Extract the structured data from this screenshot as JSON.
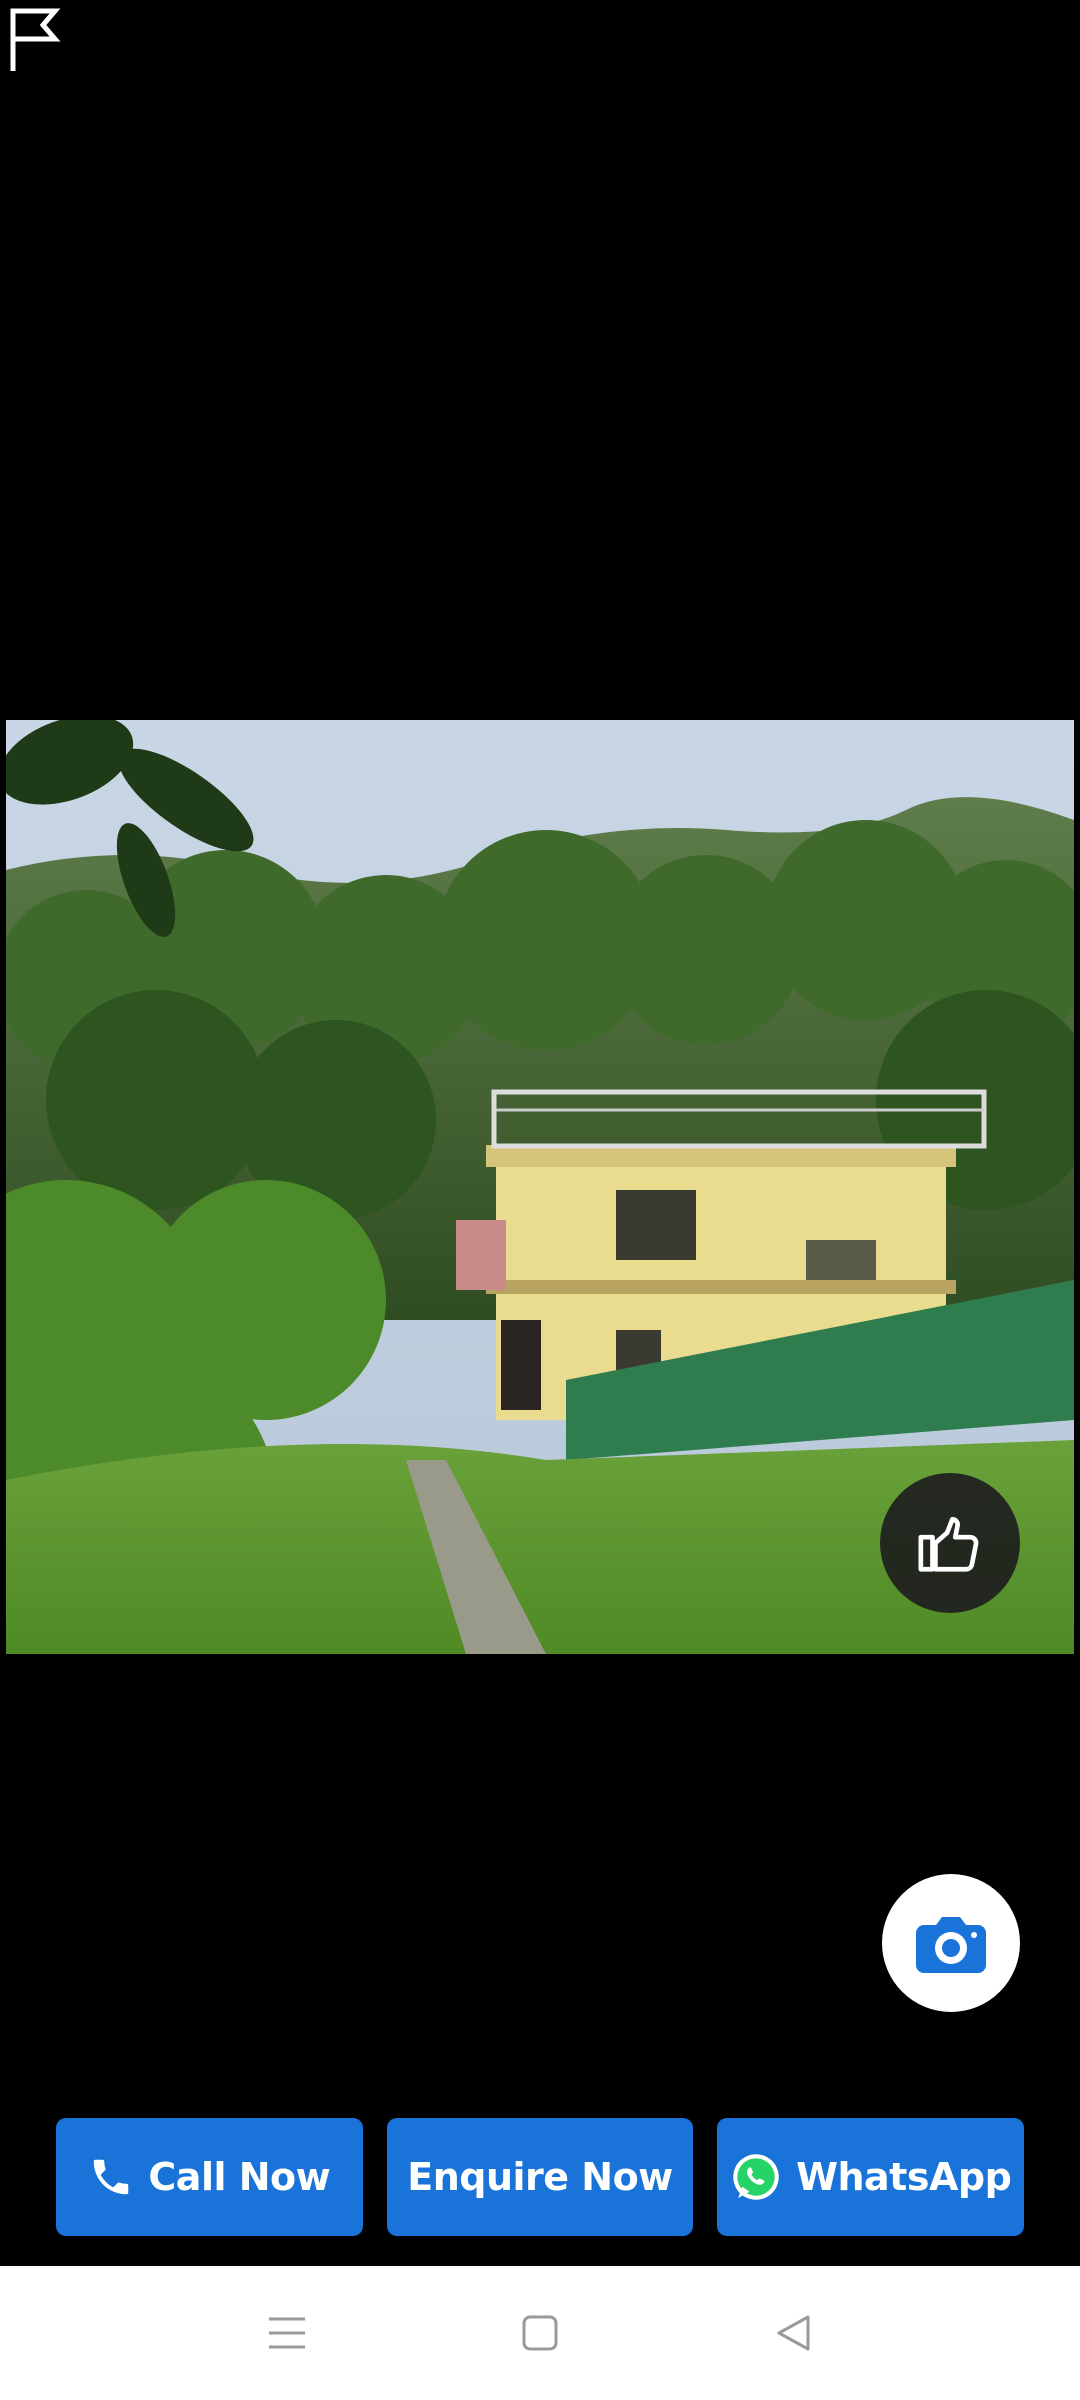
{
  "photo": {
    "alt_subject": "hillside house"
  },
  "actions": {
    "like_icon": "thumbs-up-icon",
    "report_icon": "flag-icon",
    "camera_icon": "camera-icon"
  },
  "cta": {
    "call_label": "Call Now",
    "call_icon": "phone-icon",
    "enquire_label": "Enquire Now",
    "whatsapp_label": "WhatsApp",
    "whatsapp_icon": "whatsapp-icon",
    "button_color": "#1a73d9"
  },
  "navbar": {
    "menu_icon": "menu-icon",
    "home_icon": "home-square-icon",
    "back_icon": "back-triangle-icon"
  }
}
